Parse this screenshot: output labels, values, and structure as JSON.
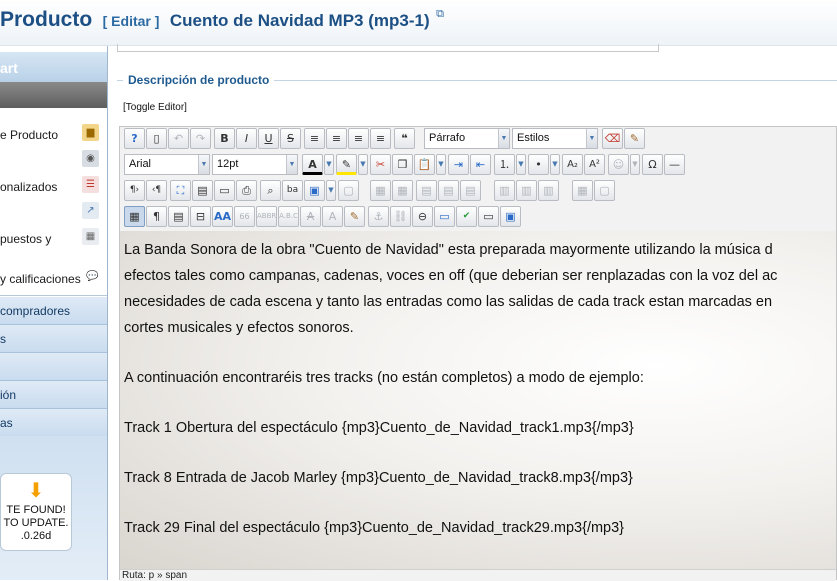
{
  "header": {
    "title": "Producto",
    "edit_label": "[ Editar ]",
    "product_name": "Cuento de Navidad MP3 (mp3-1)",
    "external_icon": "external-link-icon"
  },
  "sidebar": {
    "brand": "art",
    "items": [
      {
        "label": "e Producto",
        "icon": "folder-image-icon"
      },
      {
        "label": "",
        "icon": "camera-icon"
      },
      {
        "label": "onalizados",
        "icon": "list-icon"
      },
      {
        "label": "",
        "icon": "chart-icon"
      },
      {
        "label": "puestos y",
        "icon": "calculator-icon"
      },
      {
        "label": "y calificaciones",
        "icon": "comment-icon"
      }
    ],
    "nav": [
      "compradores",
      "s",
      "",
      "ión",
      "as"
    ],
    "update_box": {
      "line1": "TE FOUND!",
      "line2": "TO UPDATE.",
      "line3": ".0.26d"
    }
  },
  "main": {
    "legend": "Descripción de producto",
    "toggle_editor": "[Toggle Editor]"
  },
  "editor": {
    "format_select": "Párrafo",
    "styles_select": "Estilos",
    "font_select": "Arial",
    "size_select": "12pt",
    "content": {
      "p1_line1": "La Banda Sonora de la obra \"Cuento de Navidad\" esta preparada mayormente utilizando la música d",
      "p1_line2": "efectos tales como campanas, cadenas, voces en off (que deberian ser renplazadas con la voz del ac",
      "p1_line3": "necesidades de cada escena y tanto las entradas como las salidas de cada track estan marcadas en",
      "p1_line4": "cortes musicales y efectos sonoros.",
      "p2": "A continuación encontraréis tres tracks (no están completos) a modo de ejemplo:",
      "track1": "Track 1 Obertura del espectáculo  {mp3}Cuento_de_Navidad_track1.mp3{/mp3}",
      "track8": "Track 8 Entrada de Jacob Marley  {mp3}Cuento_de_Navidad_track8.mp3{/mp3}",
      "track29": "Track 29 Final del espectáculo  {mp3}Cuento_de_Navidad_track29.mp3{/mp3}"
    },
    "path": "Ruta:  p » span"
  }
}
